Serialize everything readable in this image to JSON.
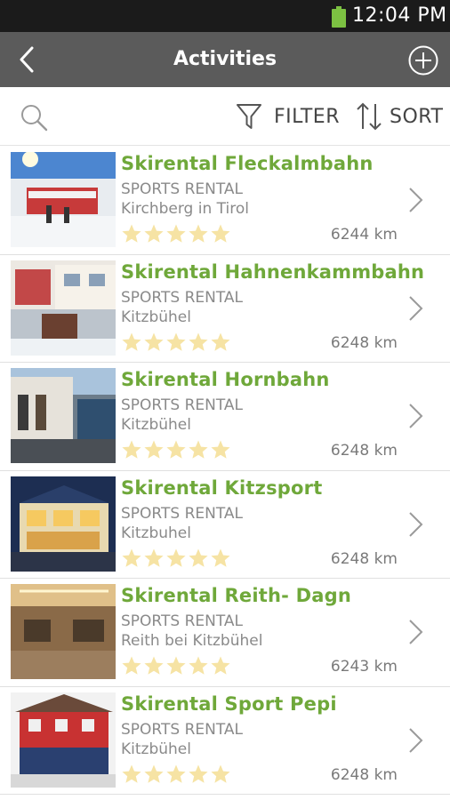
{
  "status_bar": {
    "time": "12:04 PM",
    "battery_icon": "battery-full-icon",
    "battery_color": "#7cc142"
  },
  "app_bar": {
    "title": "Activities",
    "back_icon": "back-arrow-icon",
    "add_icon": "add-circle-icon",
    "background": "#5b5b5b"
  },
  "toolbar": {
    "search_icon": "search-icon",
    "filter_label": "FILTER",
    "sort_label": "SORT"
  },
  "colors": {
    "accent_green": "#6fa83a",
    "star_color": "#f6e3a4"
  },
  "activities": [
    {
      "name": "Skirental Fleckalmbahn",
      "category": "SPORTS RENTAL",
      "location": "Kirchberg in Tirol",
      "distance": "6244 km",
      "rating": 5
    },
    {
      "name": "Skirental Hahnenkammbahn",
      "category": "SPORTS RENTAL",
      "location": "Kitzbühel",
      "distance": "6248 km",
      "rating": 5
    },
    {
      "name": "Skirental Hornbahn",
      "category": "SPORTS RENTAL",
      "location": "Kitzbühel",
      "distance": "6248 km",
      "rating": 5
    },
    {
      "name": "Skirental Kitzsport",
      "category": "SPORTS RENTAL",
      "location": "Kitzbuhel",
      "distance": "6248 km",
      "rating": 5
    },
    {
      "name": "Skirental Reith- Dagn",
      "category": "SPORTS RENTAL",
      "location": "Reith bei Kitzbühel",
      "distance": "6243 km",
      "rating": 5
    },
    {
      "name": "Skirental Sport Pepi",
      "category": "SPORTS RENTAL",
      "location": "Kitzbühel",
      "distance": "6248 km",
      "rating": 5
    }
  ]
}
